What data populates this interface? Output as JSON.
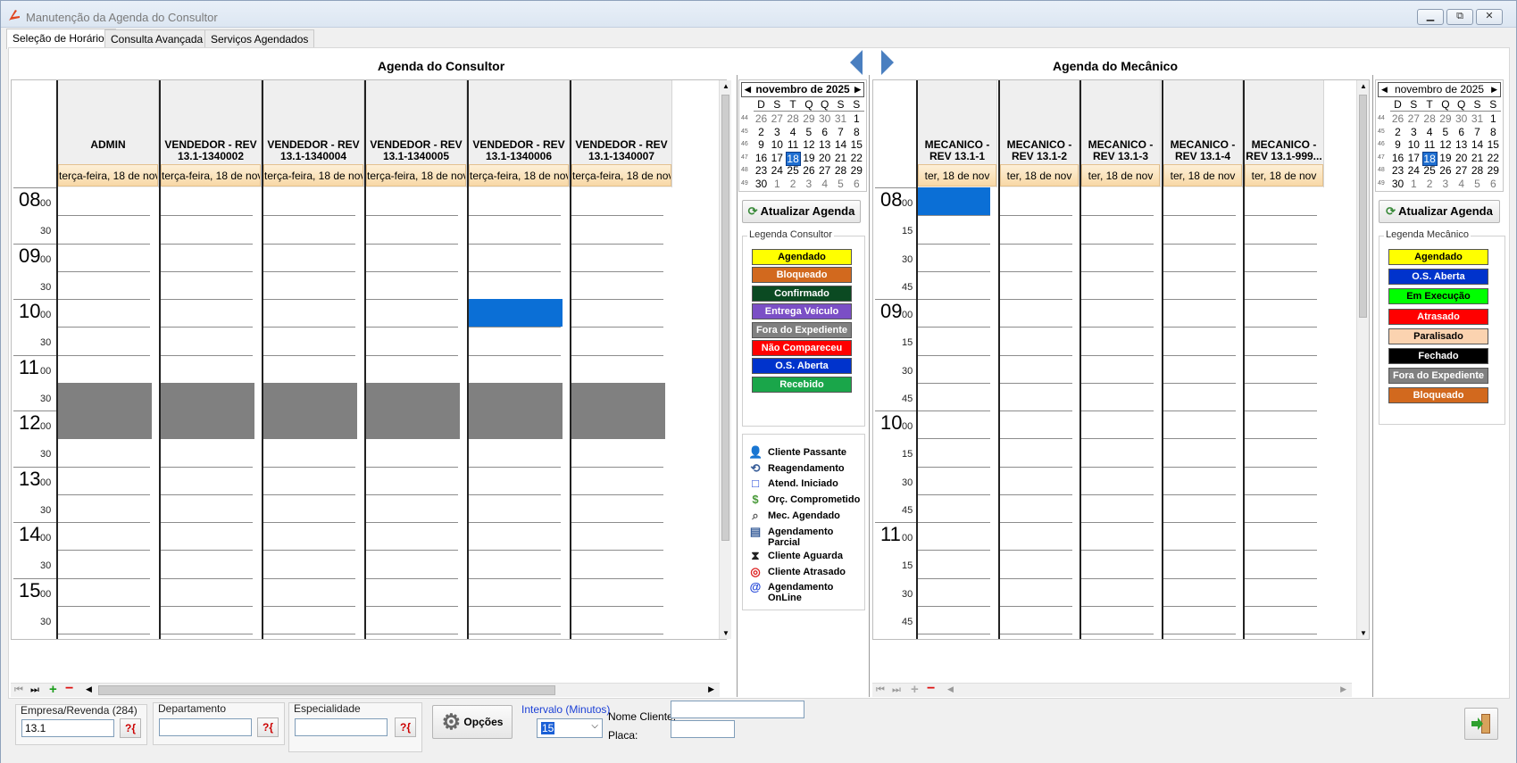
{
  "window": {
    "title": "Manutenção da Agenda do Consultor",
    "minimize": "▁",
    "maximize": "⧉",
    "close": "✕"
  },
  "tabs": [
    "Seleção de Horários",
    "Consulta Avançada",
    "Serviços Agendados"
  ],
  "consultor": {
    "title": "Agenda do Consultor",
    "columns": [
      {
        "name": "ADMIN",
        "date": "terça-feira, 18 de nov"
      },
      {
        "name": "VENDEDOR - REV 13.1-1340002",
        "date": "terça-feira, 18 de nov"
      },
      {
        "name": "VENDEDOR - REV 13.1-1340004",
        "date": "terça-feira, 18 de nov"
      },
      {
        "name": "VENDEDOR - REV 13.1-1340005",
        "date": "terça-feira, 18 de nov"
      },
      {
        "name": "VENDEDOR - REV 13.1-1340006",
        "date": "terça-feira, 18 de nov"
      },
      {
        "name": "VENDEDOR - REV 13.1-1340007",
        "date": "terça-feira, 18 de nov"
      }
    ],
    "hours": [
      "08",
      "09",
      "10",
      "11",
      "12",
      "13",
      "14",
      "15"
    ],
    "minute_labels": [
      "00",
      "30"
    ],
    "calendar": {
      "month": "novembro de 2025",
      "days": [
        "D",
        "S",
        "T",
        "Q",
        "Q",
        "S",
        "S"
      ],
      "weeks": [
        {
          "wk": "44",
          "d": [
            "26",
            "27",
            "28",
            "29",
            "30",
            "31",
            "1"
          ]
        },
        {
          "wk": "45",
          "d": [
            "2",
            "3",
            "4",
            "5",
            "6",
            "7",
            "8"
          ]
        },
        {
          "wk": "46",
          "d": [
            "9",
            "10",
            "11",
            "12",
            "13",
            "14",
            "15"
          ]
        },
        {
          "wk": "47",
          "d": [
            "16",
            "17",
            "18",
            "19",
            "20",
            "21",
            "22"
          ]
        },
        {
          "wk": "48",
          "d": [
            "23",
            "24",
            "25",
            "26",
            "27",
            "28",
            "29"
          ]
        },
        {
          "wk": "49",
          "d": [
            "30",
            "1",
            "2",
            "3",
            "4",
            "5",
            "6"
          ]
        }
      ],
      "selected": "18"
    },
    "refresh_label": "Atualizar Agenda",
    "legend_title": "Legenda Consultor",
    "legend": [
      {
        "label": "Agendado",
        "bg": "#ffff00",
        "fg": "#000000"
      },
      {
        "label": "Bloqueado",
        "bg": "#d2691e",
        "fg": "#ffffff"
      },
      {
        "label": "Confirmado",
        "bg": "#0b4a22",
        "fg": "#ffffff"
      },
      {
        "label": "Entrega Veículo",
        "bg": "#7b4fc6",
        "fg": "#ffffff"
      },
      {
        "label": "Fora do Expediente",
        "bg": "#808080",
        "fg": "#ffffff"
      },
      {
        "label": "Não Compareceu",
        "bg": "#ff0000",
        "fg": "#ffffff"
      },
      {
        "label": "O.S. Aberta",
        "bg": "#0033cc",
        "fg": "#ffffff"
      },
      {
        "label": "Recebido",
        "bg": "#1aa64a",
        "fg": "#ffffff"
      }
    ],
    "icons": [
      {
        "label": "Cliente Passante",
        "icon": "person-icon"
      },
      {
        "label": "Reagendamento",
        "icon": "reschedule-icon"
      },
      {
        "label": "Atend. Iniciado",
        "icon": "square-icon"
      },
      {
        "label": "Orç. Comprometido",
        "icon": "money-icon"
      },
      {
        "label": "Mec. Agendado",
        "icon": "mechanic-search-icon"
      },
      {
        "label": "Agendamento Parcial",
        "icon": "partial-icon"
      },
      {
        "label": "Cliente Aguarda",
        "icon": "hourglass-icon"
      },
      {
        "label": "Cliente Atrasado",
        "icon": "late-icon"
      },
      {
        "label": "Agendamento OnLine",
        "icon": "at-icon"
      }
    ]
  },
  "mecanico": {
    "title": "Agenda do Mecânico",
    "columns": [
      {
        "name": "MECANICO - REV 13.1-1",
        "date": "ter, 18 de nov"
      },
      {
        "name": "MECANICO - REV 13.1-2",
        "date": "ter, 18 de nov"
      },
      {
        "name": "MECANICO - REV 13.1-3",
        "date": "ter, 18 de nov"
      },
      {
        "name": "MECANICO - REV 13.1-4",
        "date": "ter, 18 de nov"
      },
      {
        "name": "MECANICO - REV 13.1-999...",
        "date": "ter, 18 de nov"
      }
    ],
    "hours": [
      "08",
      "09",
      "10",
      "11"
    ],
    "minute_labels": [
      "00",
      "15",
      "30",
      "45"
    ],
    "calendar": {
      "month": "novembro de 2025",
      "days": [
        "D",
        "S",
        "T",
        "Q",
        "Q",
        "S",
        "S"
      ],
      "weeks": [
        {
          "wk": "44",
          "d": [
            "26",
            "27",
            "28",
            "29",
            "30",
            "31",
            "1"
          ]
        },
        {
          "wk": "45",
          "d": [
            "2",
            "3",
            "4",
            "5",
            "6",
            "7",
            "8"
          ]
        },
        {
          "wk": "46",
          "d": [
            "9",
            "10",
            "11",
            "12",
            "13",
            "14",
            "15"
          ]
        },
        {
          "wk": "47",
          "d": [
            "16",
            "17",
            "18",
            "19",
            "20",
            "21",
            "22"
          ]
        },
        {
          "wk": "48",
          "d": [
            "23",
            "24",
            "25",
            "26",
            "27",
            "28",
            "29"
          ]
        },
        {
          "wk": "49",
          "d": [
            "30",
            "1",
            "2",
            "3",
            "4",
            "5",
            "6"
          ]
        }
      ],
      "selected": "18"
    },
    "refresh_label": "Atualizar Agenda",
    "legend_title": "Legenda Mecânico",
    "legend": [
      {
        "label": "Agendado",
        "bg": "#ffff00",
        "fg": "#000000"
      },
      {
        "label": "O.S. Aberta",
        "bg": "#0033cc",
        "fg": "#ffffff"
      },
      {
        "label": "Em Execução",
        "bg": "#00ff00",
        "fg": "#000000"
      },
      {
        "label": "Atrasado",
        "bg": "#ff0000",
        "fg": "#ffffff"
      },
      {
        "label": "Paralisado",
        "bg": "#fbd3b0",
        "fg": "#000000"
      },
      {
        "label": "Fechado",
        "bg": "#000000",
        "fg": "#ffffff"
      },
      {
        "label": "Fora do Expediente",
        "bg": "#808080",
        "fg": "#ffffff"
      },
      {
        "label": "Bloqueado",
        "bg": "#d2691e",
        "fg": "#ffffff"
      }
    ]
  },
  "footer": {
    "empresa_label": "Empresa/Revenda (284)",
    "empresa_value": "13.1",
    "departamento_label": "Departamento",
    "departamento_value": "",
    "especialidade_label": "Especialidade",
    "especialidade_value": "",
    "query_btn": "?{",
    "opcoes_label": "Opções",
    "intervalo_label": "Intervalo (Minutos)",
    "intervalo_value": "15",
    "nome_cliente_label": "Nome Cliente:",
    "nome_cliente_value": "",
    "placa_label": "Placa:",
    "placa_value": ""
  }
}
